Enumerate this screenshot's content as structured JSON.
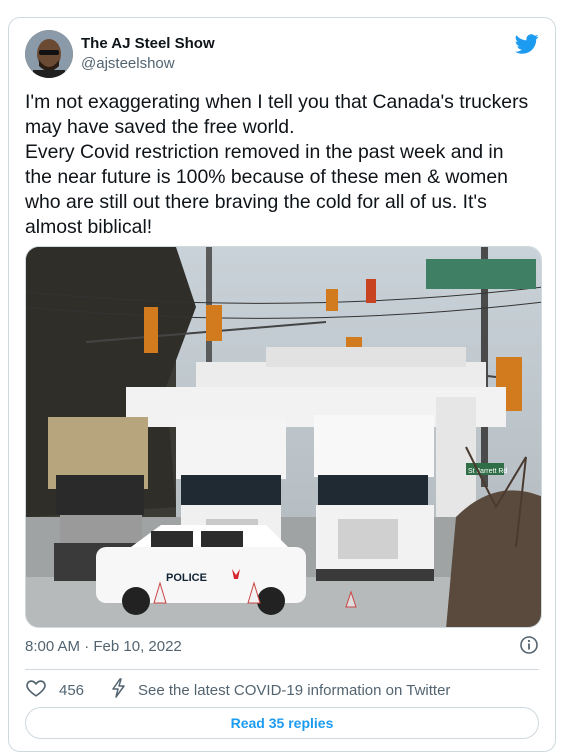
{
  "tweet": {
    "author_name": "The AJ Steel Show",
    "author_handle": "@ajsteelshow",
    "text_lines": [
      "I'm not exaggerating when I tell you that Canada's truckers may have saved the free world.",
      "Every Covid restriction removed in the past week and in the near future is 100% because of these men & women who are still out there braving the cold for all of us. It's almost biblical!"
    ],
    "timestamp": "8:00 AM · Feb 10, 2022",
    "like_count": "456",
    "covid_link": "See the latest COVID-19 information on Twitter",
    "replies_button": "Read 35 replies"
  },
  "photo": {
    "police_car_text": "POLICE",
    "street_sign_text": "St Jarrett Rd"
  },
  "icons": {
    "twitter_bird": "twitter-bird-icon",
    "info": "info-icon",
    "heart": "heart-icon",
    "lightning": "lightning-icon"
  },
  "colors": {
    "twitter_blue": "#1d9bf0",
    "text": "#0f1419",
    "secondary": "#536471",
    "border": "#cfd9de"
  }
}
